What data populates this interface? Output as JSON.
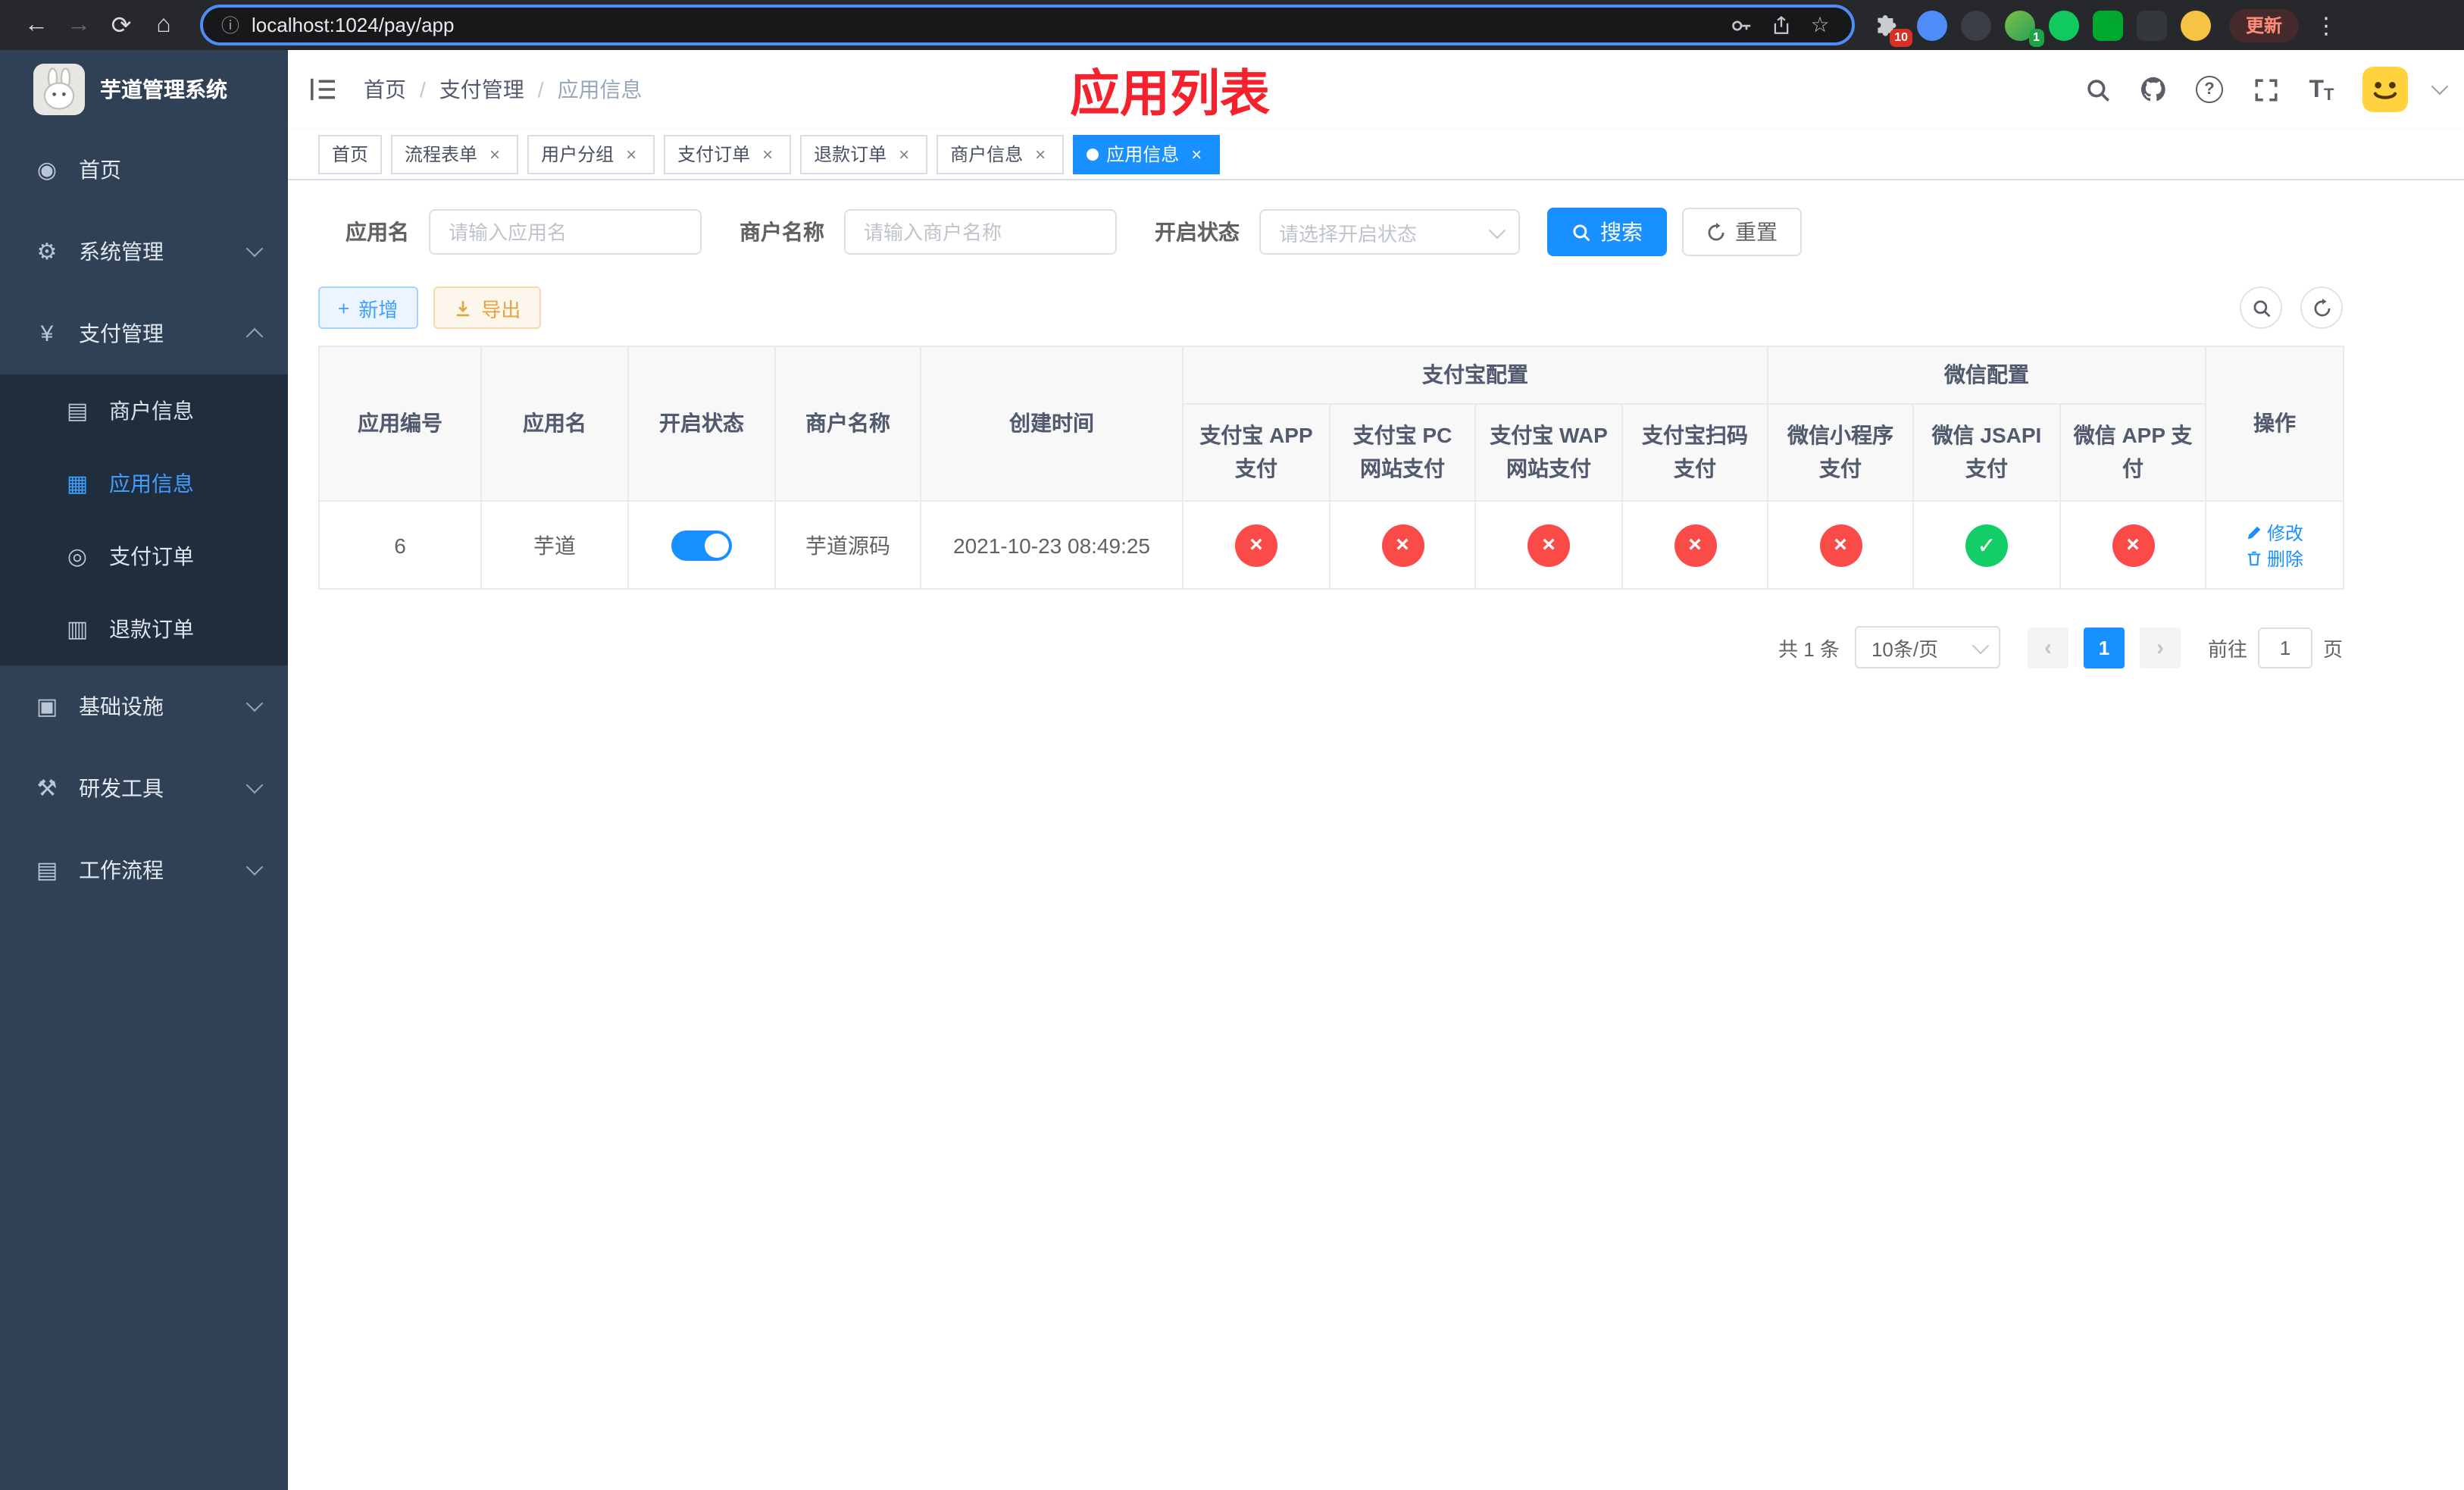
{
  "browser": {
    "url": "localhost:1024/pay/app",
    "update_label": "更新",
    "extensions_badge": "10",
    "profile_badge": "1"
  },
  "icons": {
    "back": "←",
    "forward": "→",
    "reload": "⟳",
    "home": "⌂",
    "info": "ⓘ",
    "star": "☆",
    "kebab": "⋮",
    "dashboard": "◉",
    "gear": "⚙",
    "yen": "¥",
    "card": "▤",
    "grid": "▦",
    "order": "◎",
    "doc": "▥",
    "infra": "▣",
    "tools": "⚒",
    "workflow": "▤",
    "close": "×",
    "help": "?",
    "plus": "+",
    "prev": "‹",
    "next": "›"
  },
  "sidebar": {
    "title": "芋道管理系统",
    "items": [
      {
        "label": "首页"
      },
      {
        "label": "系统管理"
      },
      {
        "label": "支付管理",
        "children": [
          {
            "label": "商户信息"
          },
          {
            "label": "应用信息"
          },
          {
            "label": "支付订单"
          },
          {
            "label": "退款订单"
          }
        ]
      },
      {
        "label": "基础设施"
      },
      {
        "label": "研发工具"
      },
      {
        "label": "工作流程"
      }
    ]
  },
  "header": {
    "breadcrumb": [
      "首页",
      "支付管理",
      "应用信息"
    ],
    "page_title": "应用列表"
  },
  "tabs": [
    {
      "label": "首页"
    },
    {
      "label": "流程表单"
    },
    {
      "label": "用户分组"
    },
    {
      "label": "支付订单"
    },
    {
      "label": "退款订单"
    },
    {
      "label": "商户信息"
    },
    {
      "label": "应用信息"
    }
  ],
  "filters": {
    "app_name_label": "应用名",
    "app_name_placeholder": "请输入应用名",
    "merchant_label": "商户名称",
    "merchant_placeholder": "请输入商户名称",
    "status_label": "开启状态",
    "status_placeholder": "请选择开启状态",
    "search_label": "搜索",
    "reset_label": "重置"
  },
  "toolbar": {
    "add_label": "新增",
    "export_label": "导出"
  },
  "table": {
    "headers": {
      "app_id": "应用编号",
      "app_name": "应用名",
      "status": "开启状态",
      "merchant": "商户名称",
      "created": "创建时间",
      "alipay_group": "支付宝配置",
      "wechat_group": "微信配置",
      "alipay_app": "支付宝 APP 支付",
      "alipay_pc": "支付宝 PC 网站支付",
      "alipay_wap": "支付宝 WAP 网站支付",
      "alipay_qr": "支付宝扫码支付",
      "wx_mini": "微信小程序支付",
      "wx_jsapi": "微信 JSAPI 支付",
      "wx_app": "微信 APP 支付",
      "actions": "操作"
    },
    "row": {
      "id": "6",
      "name": "芋道",
      "enabled": true,
      "merchant": "芋道源码",
      "created": "2021-10-23 08:49:25",
      "channels": {
        "alipay_app": false,
        "alipay_pc": false,
        "alipay_wap": false,
        "alipay_qr": false,
        "wx_mini": false,
        "wx_jsapi": true,
        "wx_app": false
      },
      "edit_label": "修改",
      "delete_label": "删除"
    }
  },
  "pagination": {
    "total": "共 1 条",
    "page_size": "10条/页",
    "current_page": "1",
    "goto_label": "前往",
    "goto_value": "1",
    "goto_suffix": "页"
  },
  "colors": {
    "primary": "#1890ff",
    "active_menu": "#409eff",
    "success": "#13ce66",
    "danger": "#fa4b49",
    "warning_text": "#e6a23c",
    "title_red": "#f5222d",
    "sidebar_bg": "#304156",
    "sidebar_sub_bg": "#1f2d3d"
  }
}
